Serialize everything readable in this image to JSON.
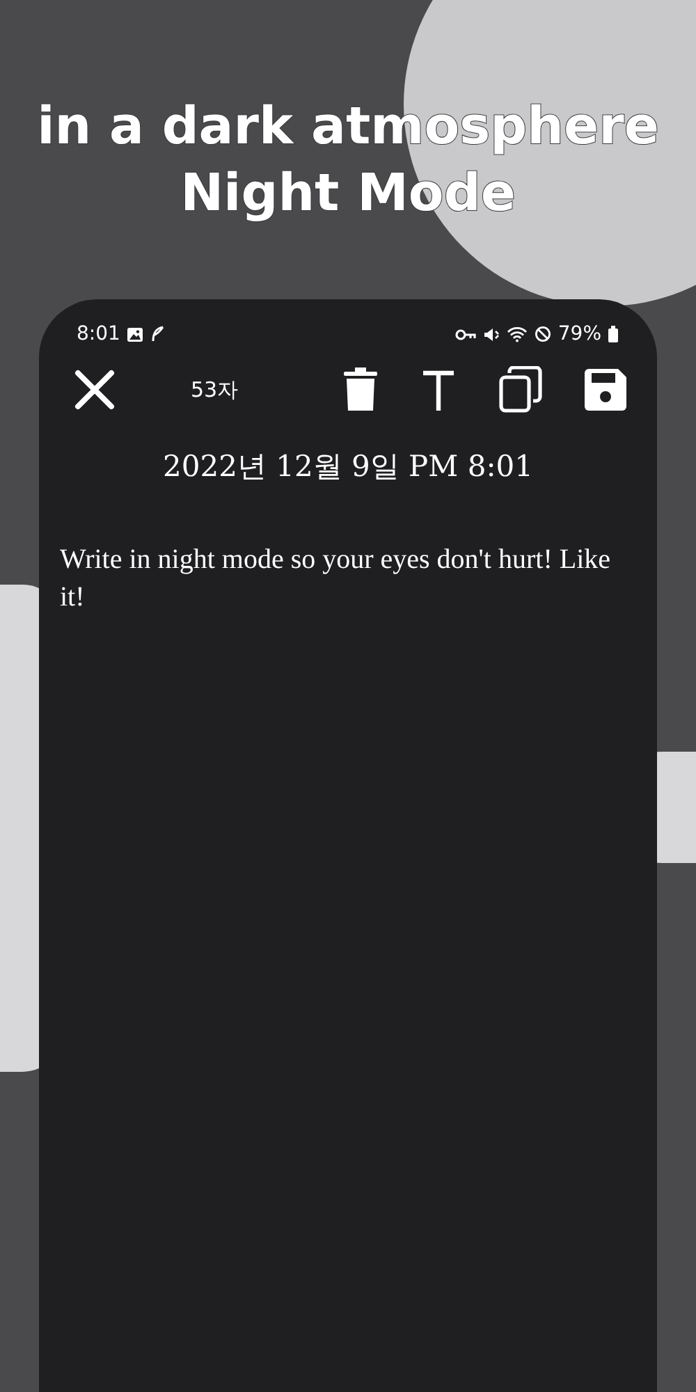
{
  "headline": {
    "lines": [
      "in a dark atmosphere",
      "Night Mode"
    ]
  },
  "status_bar": {
    "time": "8:01",
    "battery": "79%"
  },
  "toolbar": {
    "char_count": "53자"
  },
  "note": {
    "date": "2022년 12월 9일 PM 8:01",
    "body": "Write in night mode so your eyes don't hurt! Like it!"
  }
}
